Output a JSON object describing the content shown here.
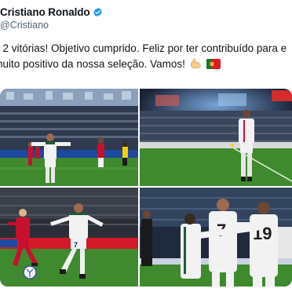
{
  "author": {
    "name": "Cristiano Ronaldo",
    "handle": "@Cristiano",
    "verified_icon": "verified-badge-icon",
    "verified_color": "#1d9bf0"
  },
  "tweet": {
    "line1": ", 2 vitórias! Objetivo cumprido. Feliz por ter contribuído para e",
    "line2": "nuito positivo da nossa seleção. Vamos!",
    "emojis": [
      "flexed-biceps-icon",
      "portugal-flag-icon"
    ]
  },
  "photos": {
    "photo3_number": "7",
    "photo4_numbers": [
      "7",
      "19"
    ],
    "colors": {
      "portugal_white": "#f2f2f2",
      "portugal_red": "#c8102e",
      "pitch_green": "#3f8a2e",
      "accent_green": "#1e5b3a"
    }
  }
}
